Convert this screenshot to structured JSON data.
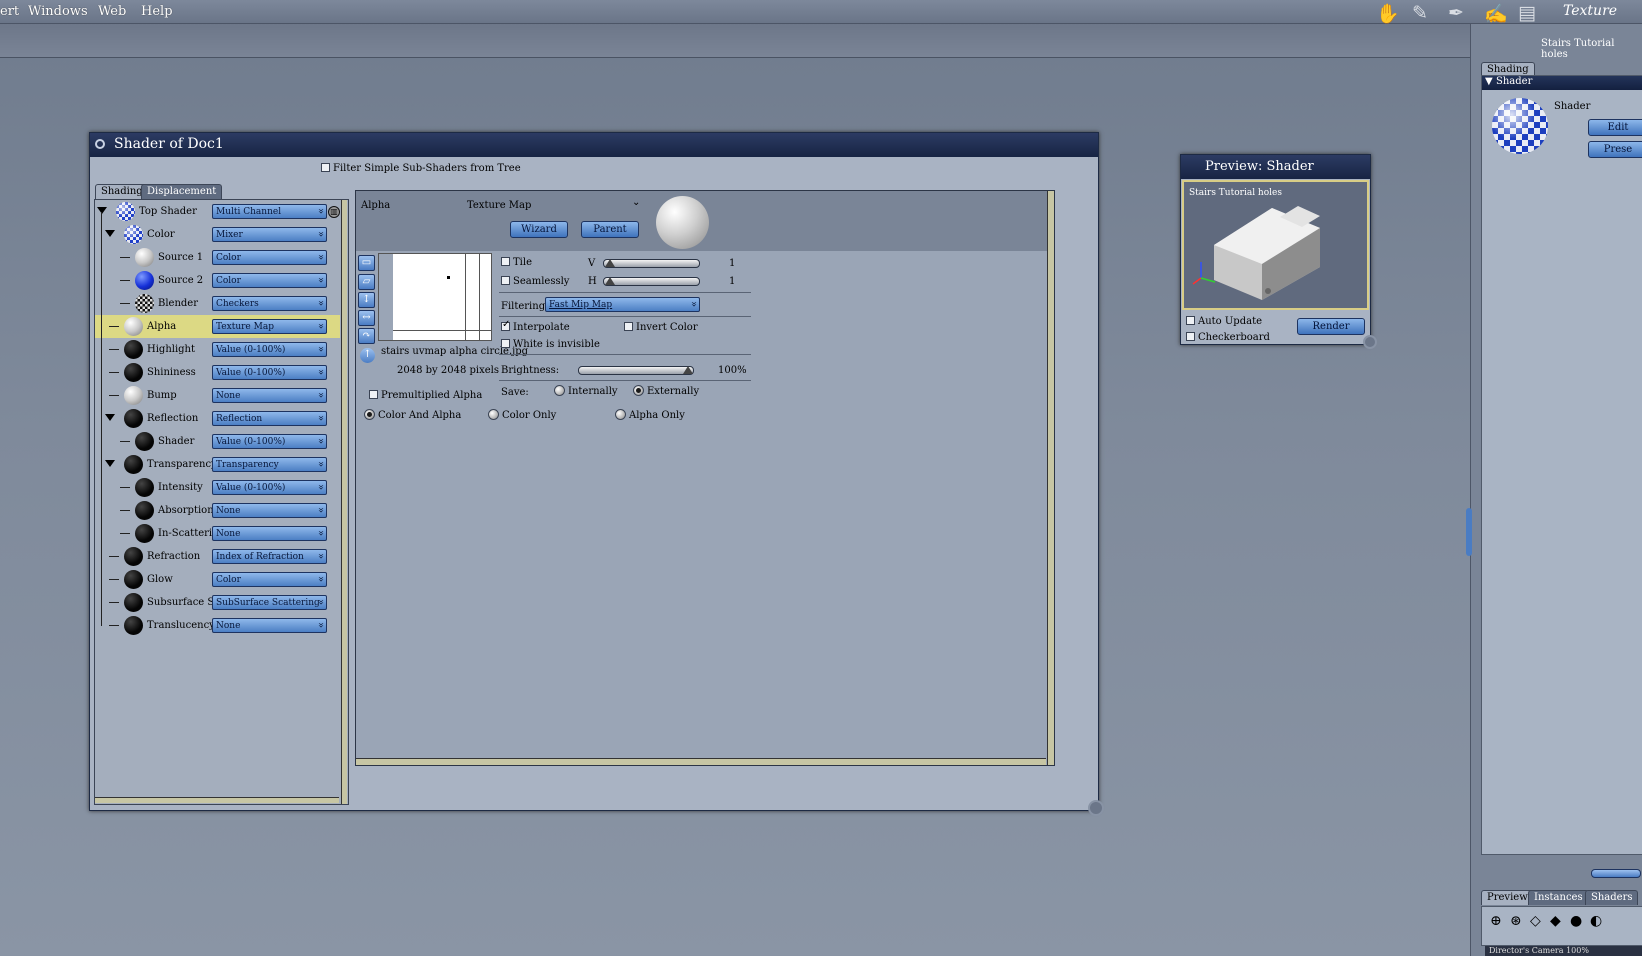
{
  "menubar": {
    "items": [
      "ert",
      "Windows",
      "Web",
      "Help"
    ],
    "room_label": "Texture"
  },
  "right_panel": {
    "title": "Stairs Tutorial holes",
    "tab_shading": "Shading",
    "shader_section": "Shader",
    "shader_label": "Shader",
    "edit_button": "Edit",
    "presets_button": "Prese",
    "bottom_tabs": [
      "Preview",
      "Instances",
      "Shaders"
    ],
    "camera_label": "Director's Camera 100%"
  },
  "shader_window": {
    "title": "Shader of Doc1",
    "filter_label": "Filter Simple Sub-Shaders from Tree",
    "tabs": [
      "Shading",
      "Displacement"
    ],
    "tree": [
      {
        "label": "Top Shader",
        "value": "Multi Channel",
        "depth": 0,
        "expanded": true,
        "ball": "checker"
      },
      {
        "label": "Color",
        "value": "Mixer",
        "depth": 1,
        "expanded": true,
        "ball": "checker"
      },
      {
        "label": "Source 1",
        "value": "Color",
        "depth": 2,
        "ball": "white"
      },
      {
        "label": "Source 2",
        "value": "Color",
        "depth": 2,
        "ball": "blue"
      },
      {
        "label": "Blender",
        "value": "Checkers",
        "depth": 2,
        "ball": "bw"
      },
      {
        "label": "Alpha",
        "value": "Texture Map",
        "depth": 1,
        "ball": "white",
        "selected": true
      },
      {
        "label": "Highlight",
        "value": "Value (0-100%)",
        "depth": 1,
        "ball": "black"
      },
      {
        "label": "Shininess",
        "value": "Value (0-100%)",
        "depth": 1,
        "ball": "black"
      },
      {
        "label": "Bump",
        "value": "None",
        "depth": 1,
        "ball": "white"
      },
      {
        "label": "Reflection",
        "value": "Reflection",
        "depth": 1,
        "expanded": true,
        "ball": "black"
      },
      {
        "label": "Shader",
        "value": "Value (0-100%)",
        "depth": 2,
        "ball": "black"
      },
      {
        "label": "Transparency",
        "value": "Transparency",
        "depth": 1,
        "expanded": true,
        "ball": "black"
      },
      {
        "label": "Intensity",
        "value": "Value (0-100%)",
        "depth": 2,
        "ball": "black"
      },
      {
        "label": "Absorption",
        "value": "None",
        "depth": 2,
        "ball": "black"
      },
      {
        "label": "In-Scattering",
        "value": "None",
        "depth": 2,
        "ball": "black"
      },
      {
        "label": "Refraction",
        "value": "Index of Refraction",
        "depth": 1,
        "ball": "black"
      },
      {
        "label": "Glow",
        "value": "Color",
        "depth": 1,
        "ball": "black"
      },
      {
        "label": "Subsurface Scat",
        "value": "SubSurface Scattering",
        "depth": 1,
        "ball": "black"
      },
      {
        "label": "Translucency",
        "value": "None",
        "depth": 1,
        "ball": "black"
      }
    ],
    "editor": {
      "channel": "Alpha",
      "type": "Texture Map",
      "wizard_button": "Wizard",
      "parent_button": "Parent",
      "file_name": "stairs uvmap alpha circle.jpg",
      "file_size": "2048 by 2048 pixels",
      "tile_label": "Tile",
      "seamlessly_label": "Seamlessly",
      "v_label": "V",
      "h_label": "H",
      "v_value": "1",
      "h_value": "1",
      "filtering_label": "Filtering:",
      "filtering_value": "Fast Mip Map",
      "interpolate_label": "Interpolate",
      "interpolate_checked": true,
      "invert_color_label": "Invert Color",
      "white_invisible_label": "White is invisible",
      "brightness_label": "Brightness:",
      "brightness_value": "100%",
      "save_label": "Save:",
      "internally_label": "Internally",
      "externally_label": "Externally",
      "premultiplied_label": "Premultiplied Alpha",
      "color_and_alpha_label": "Color And Alpha",
      "color_only_label": "Color Only",
      "alpha_only_label": "Alpha Only"
    }
  },
  "preview_window": {
    "title": "Preview: Shader",
    "scene_label": "Stairs Tutorial holes",
    "auto_update_label": "Auto Update",
    "checkerboard_label": "Checkerboard",
    "render_button": "Render"
  },
  "colors": {
    "accent_blue": "#4c7fc4",
    "title_bar": "#1b2848",
    "selection": "#dcd984"
  }
}
